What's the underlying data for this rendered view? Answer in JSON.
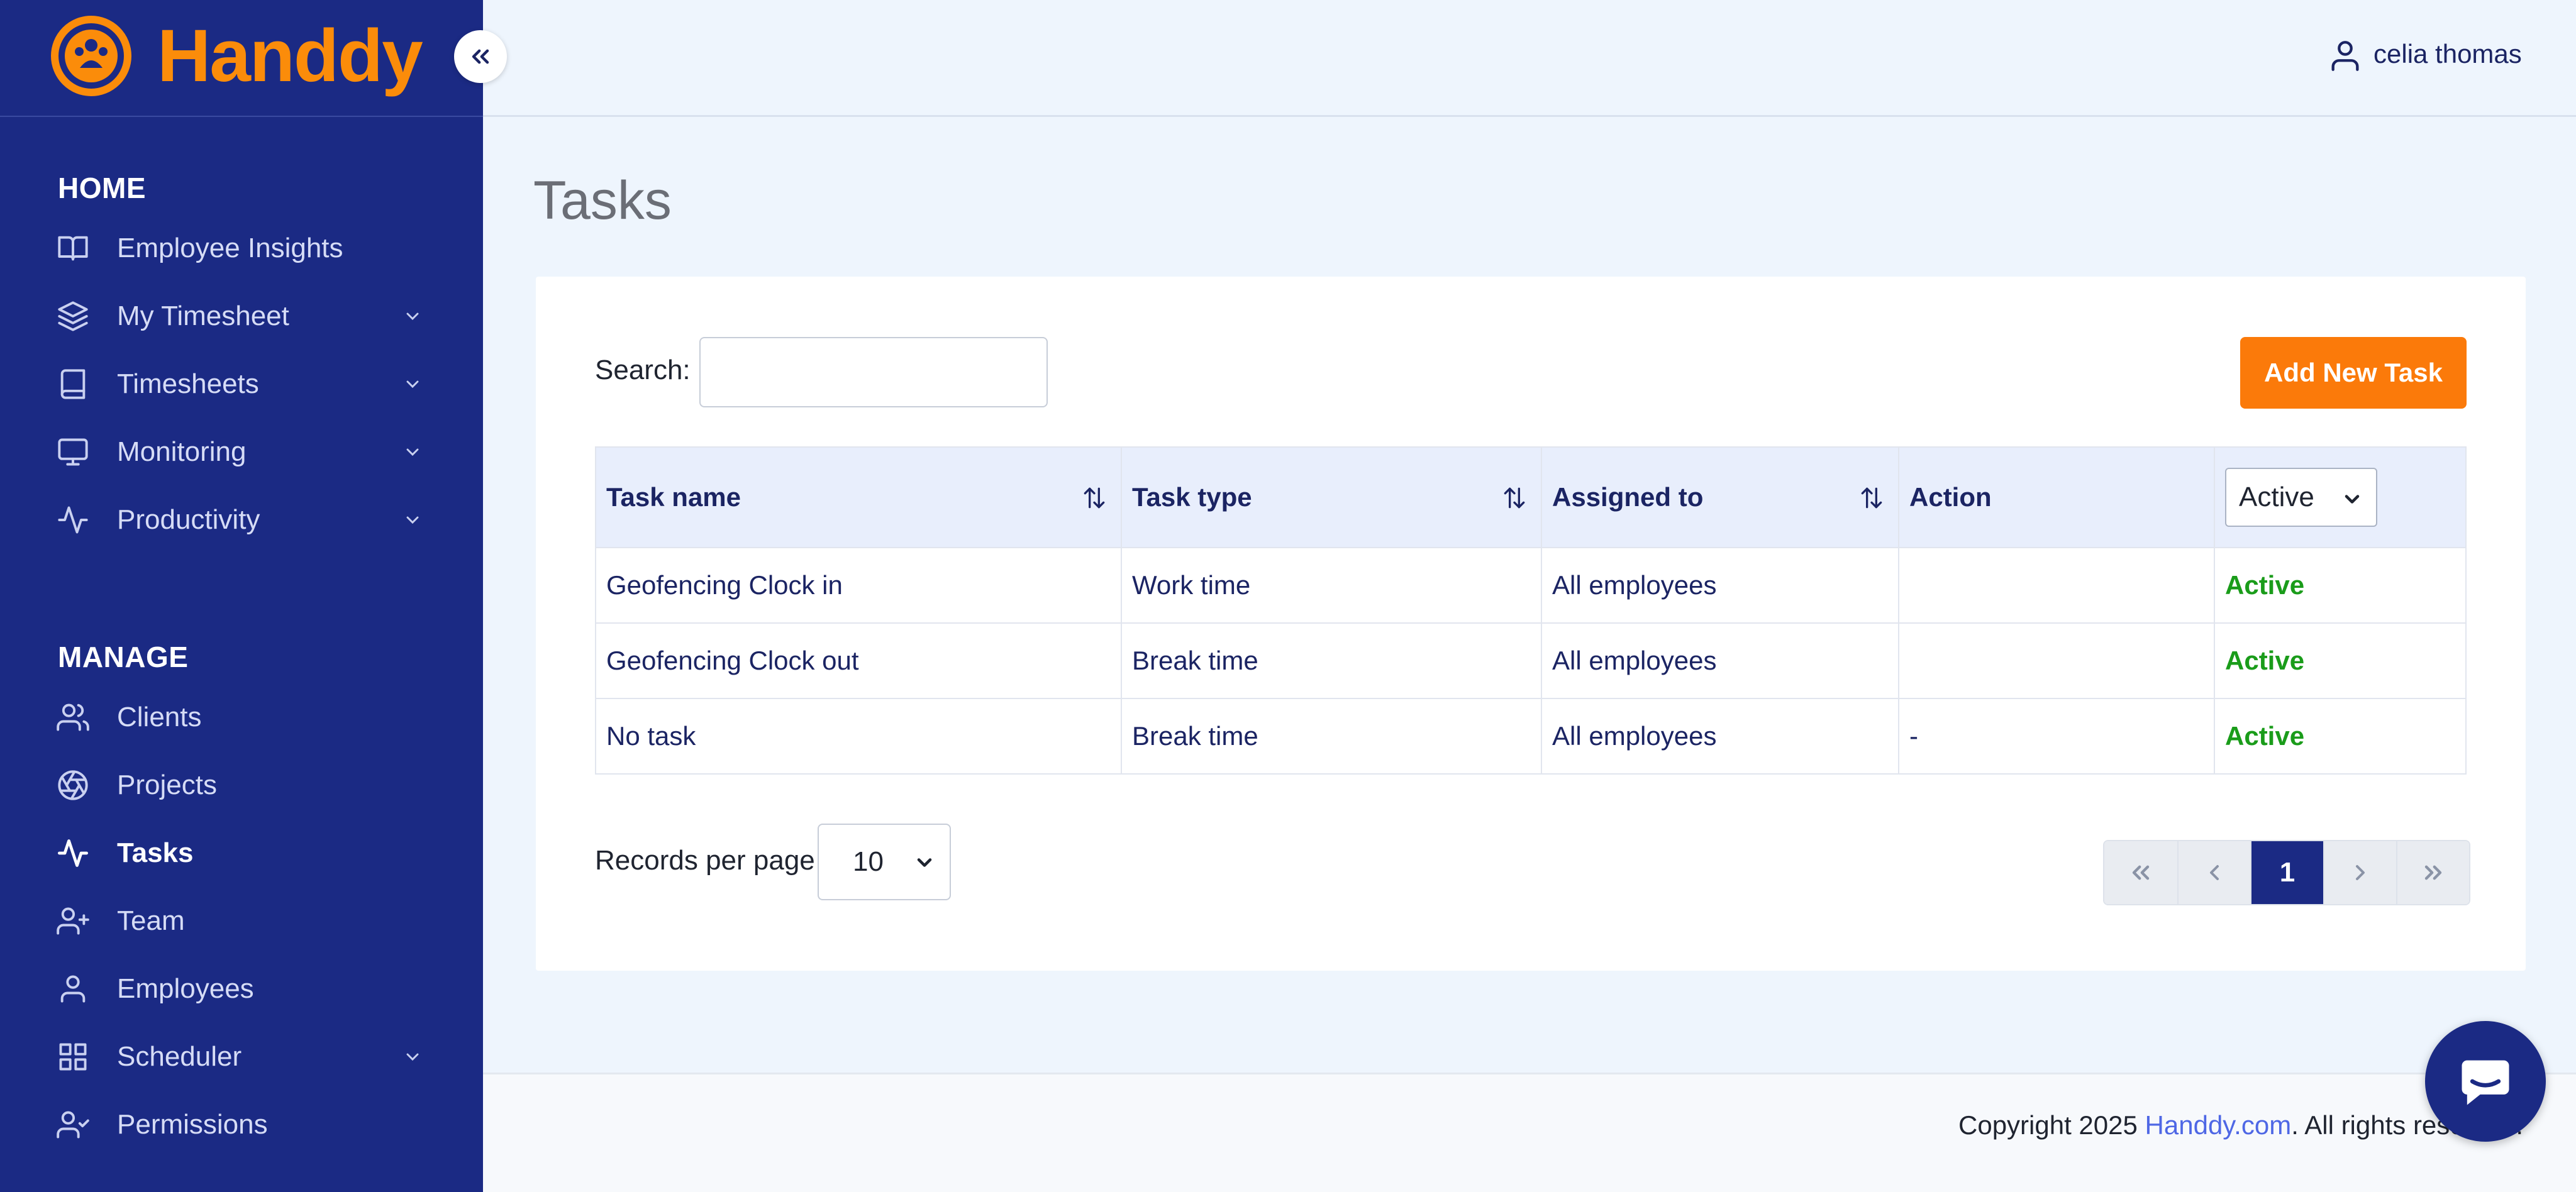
{
  "brand": {
    "name": "Handdy",
    "color": "#fb8c0a"
  },
  "sidebar": {
    "home_heading": "HOME",
    "manage_heading": "MANAGE",
    "home_items": [
      {
        "label": "Employee Insights",
        "icon": "book-open-icon",
        "has_submenu": false
      },
      {
        "label": "My Timesheet",
        "icon": "layers-icon",
        "has_submenu": true
      },
      {
        "label": "Timesheets",
        "icon": "book-icon",
        "has_submenu": true
      },
      {
        "label": "Monitoring",
        "icon": "monitor-icon",
        "has_submenu": true
      },
      {
        "label": "Productivity",
        "icon": "activity-icon",
        "has_submenu": true
      }
    ],
    "manage_items": [
      {
        "label": "Clients",
        "icon": "users-icon",
        "has_submenu": false
      },
      {
        "label": "Projects",
        "icon": "aperture-icon",
        "has_submenu": false
      },
      {
        "label": "Tasks",
        "icon": "activity-icon",
        "has_submenu": false,
        "active": true
      },
      {
        "label": "Team",
        "icon": "user-plus-icon",
        "has_submenu": false
      },
      {
        "label": "Employees",
        "icon": "user-icon",
        "has_submenu": false
      },
      {
        "label": "Scheduler",
        "icon": "grid-icon",
        "has_submenu": true
      },
      {
        "label": "Permissions",
        "icon": "user-check-icon",
        "has_submenu": false
      }
    ]
  },
  "header": {
    "user_name": "celia thomas"
  },
  "page": {
    "title": "Tasks"
  },
  "toolbar": {
    "search_label": "Search:",
    "search_value": "",
    "add_button_label": "Add New Task"
  },
  "table": {
    "columns": [
      "Task name",
      "Task type",
      "Assigned to",
      "Action"
    ],
    "status_filter": "Active",
    "rows": [
      {
        "task_name": "Geofencing Clock in",
        "task_type": "Work time",
        "assigned_to": "All employees",
        "action": "",
        "status": "Active"
      },
      {
        "task_name": "Geofencing Clock out",
        "task_type": "Break time",
        "assigned_to": "All employees",
        "action": "",
        "status": "Active"
      },
      {
        "task_name": "No task",
        "task_type": "Break time",
        "assigned_to": "All employees",
        "action": "-",
        "status": "Active"
      }
    ]
  },
  "pagination": {
    "records_label": "Records per page",
    "records_value": "10",
    "current_page": "1"
  },
  "footer": {
    "copyright_prefix": "Copyright 2025 ",
    "link_text": "Handdy.com",
    "copyright_suffix": ". All rights reserved."
  },
  "colors": {
    "sidebar_bg": "#1b2a84",
    "accent_orange": "#fb7a0a",
    "status_active": "#1a9c1a",
    "link": "#4e67e5"
  }
}
